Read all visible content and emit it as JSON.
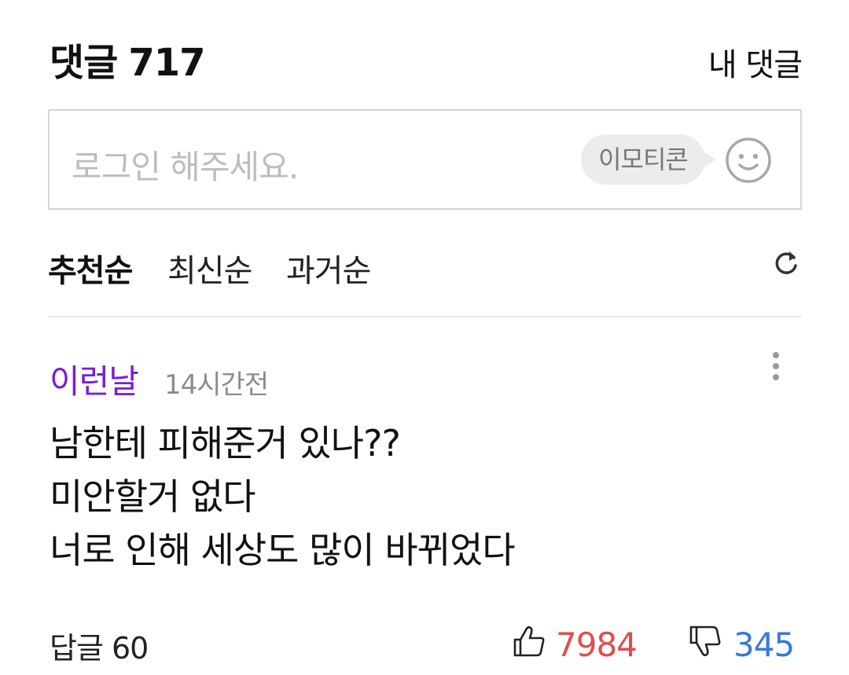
{
  "header": {
    "title": "댓글",
    "count": "717",
    "my_comments_label": "내 댓글"
  },
  "input": {
    "placeholder": "로그인 해주세요.",
    "emoticon_label": "이모티콘",
    "smiley_icon": "smiley-icon"
  },
  "sort": {
    "options": [
      {
        "label": "추천순",
        "active": true
      },
      {
        "label": "최신순",
        "active": false
      },
      {
        "label": "과거순",
        "active": false
      }
    ],
    "refresh_icon": "refresh-icon"
  },
  "comment": {
    "author": "이런날",
    "time": "14시간전",
    "lines": [
      "남한테 피해준거 있나??",
      "미안할거 없다",
      "너로 인해 세상도 많이 바뀌었다"
    ],
    "replies_label": "답글 60",
    "likes": "7984",
    "dislikes": "345"
  },
  "colors": {
    "author": "#7a1fd6",
    "like": "#e24c4c",
    "dislike": "#3a78d8",
    "placeholder": "#bdbdbd",
    "border": "#d4d4d4"
  }
}
